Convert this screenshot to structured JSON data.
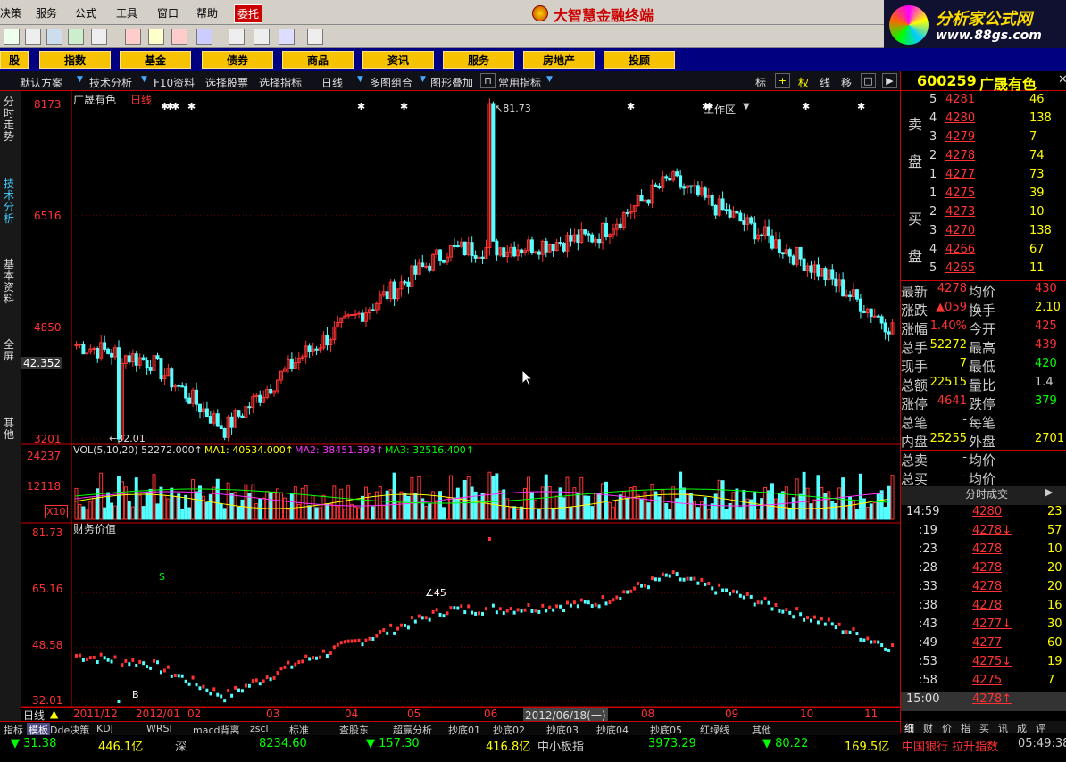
{
  "menu": {
    "items": [
      "决策",
      "服务",
      "公式",
      "工具",
      "窗口",
      "帮助",
      "委托"
    ],
    "title": "大智慧金融终端"
  },
  "banner": {
    "line1": "分析家公式网",
    "line2": "www.88gs.com"
  },
  "categories": [
    "股",
    "指数",
    "基金",
    "债券",
    "商品",
    "资讯",
    "服务",
    "房地产",
    "投顾"
  ],
  "workarea": "工作区",
  "funcbar": {
    "items": [
      "默认方案",
      "技术分析",
      "F10资料",
      "选择股票",
      "选择指标",
      "日线",
      "多图组合",
      "图形叠加",
      "常用指标"
    ],
    "right": [
      "标",
      "权",
      "线",
      "移"
    ]
  },
  "lefttabs": [
    "分时走势",
    "技术分析",
    "基本资料",
    "全屏",
    "其他"
  ],
  "stock": {
    "code": "600259",
    "name": "广晟有色"
  },
  "chart": {
    "header": "广晟有色",
    "period": "日线",
    "price_axis": [
      "8173",
      "6516",
      "4850",
      "3201"
    ],
    "cursor_value": "42.352",
    "high_label": "81.73",
    "low_label": "32.01",
    "vol_legend": [
      "VOL(5,10,20) 52272.000↑",
      "MA1: 40534.000↑",
      "MA2: 38451.398↑",
      "MA3: 32516.400↑"
    ],
    "vol_axis": [
      "24237",
      "12118"
    ],
    "vol_unit": "X10",
    "fin_title": "财务价值",
    "fin_axis": [
      "81.73",
      "65.16",
      "48.58",
      "32.01"
    ],
    "fin_marks": [
      "∠45",
      "S",
      "B"
    ],
    "date_axis": [
      "日线",
      "2011/12",
      "2012/01",
      "02",
      "03",
      "04",
      "05",
      "06",
      "2012/06/18(一)",
      "08",
      "09",
      "10",
      "11"
    ]
  },
  "chart_data": {
    "type": "candlestick",
    "title": "广晟有色 日线",
    "ylim": [
      32.01,
      81.73
    ],
    "high": 81.73,
    "low": 32.01,
    "close_by_month": {
      "2011/12": 33.5,
      "2012/01": 44,
      "02": 52,
      "03": 60,
      "04": 60.5,
      "05": 62,
      "06": 70.5,
      "07": 64,
      "08": 57,
      "09": 48.5,
      "10": 46,
      "11": 43.5
    },
    "volume_ylim": [
      0,
      24237
    ]
  },
  "quote": {
    "sell_label": [
      "卖",
      "盘"
    ],
    "buy_label": [
      "买",
      "盘"
    ],
    "sell": [
      {
        "n": "5",
        "p": "4281",
        "v": "46"
      },
      {
        "n": "4",
        "p": "4280",
        "v": "138"
      },
      {
        "n": "3",
        "p": "4279",
        "v": "7"
      },
      {
        "n": "2",
        "p": "4278",
        "v": "74"
      },
      {
        "n": "1",
        "p": "4277",
        "v": "73"
      }
    ],
    "buy": [
      {
        "n": "1",
        "p": "4275",
        "v": "39"
      },
      {
        "n": "2",
        "p": "4273",
        "v": "10"
      },
      {
        "n": "3",
        "p": "4270",
        "v": "138"
      },
      {
        "n": "4",
        "p": "4266",
        "v": "67"
      },
      {
        "n": "5",
        "p": "4265",
        "v": "11"
      }
    ],
    "stats": [
      [
        "最新",
        "4278",
        "均价",
        "430"
      ],
      [
        "涨跌",
        "▲059",
        "换手",
        "2.10"
      ],
      [
        "涨幅",
        "1.40%",
        "今开",
        "425"
      ],
      [
        "总手",
        "52272",
        "最高",
        "439"
      ],
      [
        "现手",
        "7",
        "最低",
        "420"
      ],
      [
        "总额",
        "22515",
        "量比",
        "1.4"
      ],
      [
        "涨停",
        "4641",
        "跌停",
        "379"
      ],
      [
        "总笔",
        "-",
        "每笔",
        ""
      ],
      [
        "内盘",
        "25255",
        "外盘",
        "2701"
      ],
      [
        "总卖",
        "-",
        "均价",
        ""
      ],
      [
        "总买",
        "-",
        "均价",
        ""
      ]
    ],
    "ticks_title": "分时成交",
    "ticks": [
      [
        "14:59",
        "4280",
        "23"
      ],
      [
        ":19",
        "4278↓",
        "57"
      ],
      [
        ":23",
        "4278",
        "10"
      ],
      [
        ":28",
        "4278",
        "20"
      ],
      [
        ":33",
        "4278",
        "20"
      ],
      [
        ":38",
        "4278",
        "16"
      ],
      [
        ":43",
        "4277↓",
        "30"
      ],
      [
        ":49",
        "4277",
        "60"
      ],
      [
        ":53",
        "4275↓",
        "19"
      ],
      [
        ":58",
        "4275",
        "7"
      ],
      [
        "15:00",
        "4278↑",
        ""
      ]
    ],
    "bottom_tabs": [
      "细",
      "财",
      "价",
      "指",
      "买",
      "讯",
      "成",
      "评"
    ]
  },
  "bottomtabs": [
    "指标",
    "模板",
    "Dde决策",
    "KDJ",
    "WRSI",
    "macd背离",
    "zscl",
    "标准",
    "查股东",
    "超赢分析",
    "抄底01",
    "抄底02",
    "抄底03",
    "抄底04",
    "抄底05",
    "红绿线",
    "其他"
  ],
  "status": [
    {
      "t": "▼ 31.38",
      "c": "#0f0"
    },
    {
      "t": "446.1亿",
      "c": "#ff0"
    },
    {
      "t": "深",
      "c": "#ccc"
    },
    {
      "t": "8234.60",
      "c": "#0f0"
    },
    {
      "t": "▼ 157.30",
      "c": "#0f0"
    },
    {
      "t": "416.8亿",
      "c": "#ff0"
    },
    {
      "t": "中小板指",
      "c": "#ccc"
    },
    {
      "t": "3973.29",
      "c": "#0f0"
    },
    {
      "t": "▼ 80.22",
      "c": "#0f0"
    },
    {
      "t": "169.5亿",
      "c": "#ff0"
    },
    {
      "t": "中国银行 拉升指数",
      "c": "#f33"
    },
    {
      "t": "05:49:38",
      "c": "#ccc"
    }
  ]
}
